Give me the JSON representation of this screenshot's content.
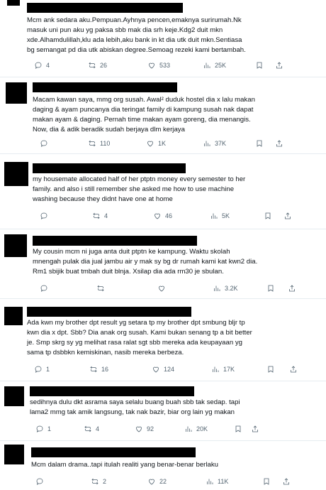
{
  "tweets": [
    {
      "text": "Mcm ank sedara aku.Pempuan.Ayhnya pencen,emaknya surirumah.Nk\nmasuk uni pun aku yg paksa sbb mak dia srh keje.Kdg2 duit mkn\nxde.Alhamdulillah,klu ada lebih,aku bank in kt dia utk duit mkn.Sentiasa\nbg semangat pd dia utk abiskan degree.Semoag rezeki kami bertambah.",
      "replies": "4",
      "reposts": "26",
      "likes": "533",
      "views": "25K"
    },
    {
      "text": "Macam kawan saya, mmg org susah. Awal² duduk hostel dia x lalu makan\ndaging & ayam puncanya dia teringat family di kampung susah nak dapat\nmakan ayam & daging. Pernah time makan ayam goreng, dia menangis.\nNow, dia & adik beradik sudah berjaya dlm kerjaya",
      "replies": "",
      "reposts": "110",
      "likes": "1K",
      "views": "37K"
    },
    {
      "text": "my housemate allocated half of her ptptn money every semester to her\nfamily. and also i still remember she asked me how to use machine\nwashing because they didnt have one at home",
      "replies": "",
      "reposts": "4",
      "likes": "46",
      "views": "5K"
    },
    {
      "text": "My cousin mcm ni juga anta duit ptptn ke kampung. Waktu skolah\nmnengah pulak dia jual jambu air y mak sy bg dr rumah kami kat kwn2 dia.\nRm1 sbijik buat tmbah duit blnja. Xsilap dia ada rm30 je sbulan.",
      "replies": "",
      "reposts": "",
      "likes": "",
      "views": "3.2K"
    },
    {
      "text": "Ada kwn my brother dpt result yg setara tp my brother dpt smbung bljr tp\nkwn dia x dpt. Sbb? Dia anak org susah. Kami bukan senang tp a bit better\nje. Smp skrg sy yg melihat rasa ralat sgt sbb mereka ada keupayaan yg\nsama tp dsbbkn kemiskinan, nasib mereka berbeza.",
      "replies": "1",
      "reposts": "16",
      "likes": "124",
      "views": "17K"
    },
    {
      "text": "sedihnya dulu dkt asrama saya selalu buang buah sbb tak sedap. tapi\nlama2 mmg tak amik langsung, tak nak bazir, biar org lain yg makan",
      "replies": "1",
      "reposts": "4",
      "likes": "92",
      "views": "20K"
    },
    {
      "text": "Mcm dalam drama..tapi itulah realiti yang benar-benar berlaku",
      "replies": "",
      "reposts": "2",
      "likes": "22",
      "views": "11K"
    }
  ]
}
